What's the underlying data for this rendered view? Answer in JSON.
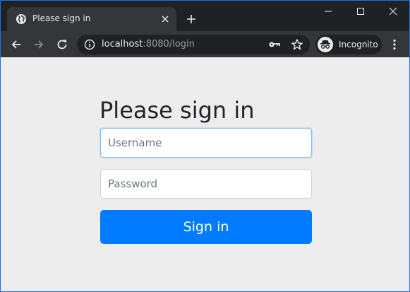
{
  "tab": {
    "title": "Please sign in",
    "favicon": "globe-icon"
  },
  "toolbar": {
    "url_host": "localhost",
    "url_rest": ":8080/login",
    "profile_label": "Incognito"
  },
  "form": {
    "heading": "Please sign in",
    "username_placeholder": "Username",
    "password_placeholder": "Password",
    "submit_label": "Sign in"
  },
  "colors": {
    "primary": "#007bff",
    "page_background": "#ededed",
    "chrome_dark": "#202124",
    "chrome_toolbar": "#35363a",
    "window_border": "#1a73e8"
  }
}
